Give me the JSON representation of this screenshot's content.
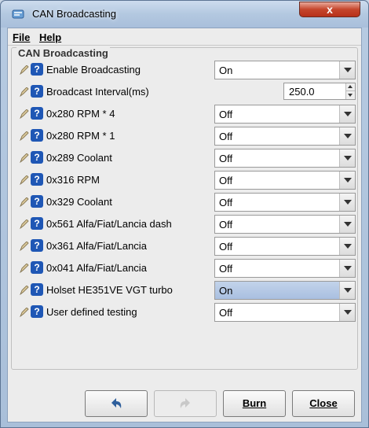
{
  "window": {
    "title": "CAN Broadcasting",
    "close_label": "x"
  },
  "menu": {
    "file_label": "File",
    "help_label": "Help"
  },
  "panel": {
    "title": "CAN Broadcasting"
  },
  "rows": [
    {
      "label": "Enable Broadcasting",
      "type": "combo",
      "value": "On"
    },
    {
      "label": "Broadcast Interval(ms)",
      "type": "spinner",
      "value": "250.0"
    },
    {
      "label": "0x280 RPM * 4",
      "type": "combo",
      "value": "Off"
    },
    {
      "label": "0x280 RPM * 1",
      "type": "combo",
      "value": "Off"
    },
    {
      "label": "0x289 Coolant",
      "type": "combo",
      "value": "Off"
    },
    {
      "label": "0x316 RPM",
      "type": "combo",
      "value": "Off"
    },
    {
      "label": "0x329 Coolant",
      "type": "combo",
      "value": "Off"
    },
    {
      "label": "0x561 Alfa/Fiat/Lancia dash",
      "type": "combo",
      "value": "Off"
    },
    {
      "label": "0x361 Alfa/Fiat/Lancia",
      "type": "combo",
      "value": "Off"
    },
    {
      "label": "0x041 Alfa/Fiat/Lancia",
      "type": "combo",
      "value": "Off"
    },
    {
      "label": "Holset HE351VE VGT turbo",
      "type": "combo",
      "value": "On",
      "selected": true
    },
    {
      "label": "User defined testing",
      "type": "combo",
      "value": "Off"
    }
  ],
  "buttons": {
    "burn_label": "Burn",
    "close_label": "Close"
  },
  "icons": {
    "title": "can-window-icon",
    "row_pencil": "pencil-icon",
    "row_help": "help-icon",
    "undo": "undo-icon",
    "redo": "redo-icon"
  },
  "colors": {
    "help_blue": "#1f57b5",
    "selected_combo": "#aec3e2"
  },
  "help_glyph": "?"
}
